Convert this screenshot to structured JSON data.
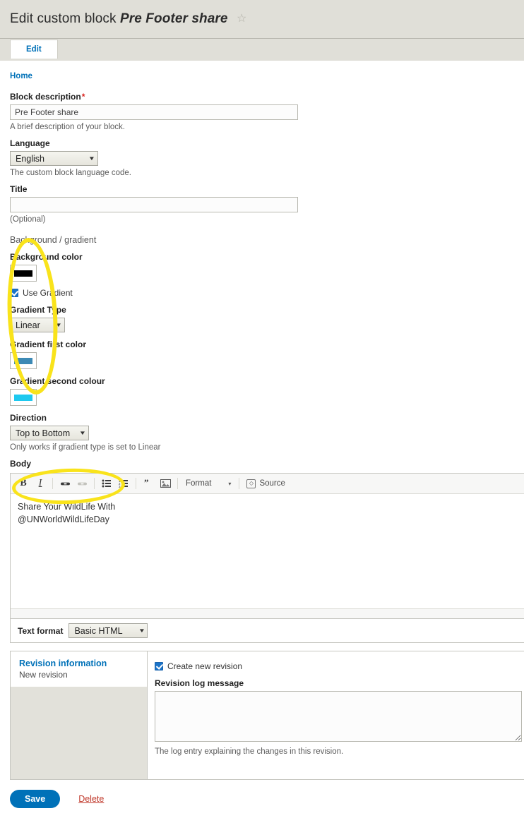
{
  "header": {
    "title_lead": "Edit custom block",
    "title_name": "Pre Footer share",
    "star_icon": "☆"
  },
  "tabs": [
    {
      "label": "Edit",
      "active": true
    }
  ],
  "breadcrumb": {
    "home_label": "Home"
  },
  "form": {
    "block_description": {
      "label": "Block description",
      "required_marker": "*",
      "value": "Pre Footer share",
      "help": "A brief description of your block."
    },
    "language": {
      "label": "Language",
      "selected": "English",
      "help": "The custom block language code."
    },
    "title": {
      "label": "Title",
      "value": "",
      "help": "(Optional)"
    },
    "background_section": {
      "legend": "Background / gradient",
      "background_color": {
        "label": "Background color",
        "value": "#000000"
      },
      "use_gradient": {
        "label": "Use Gradient",
        "checked": true
      },
      "gradient_type": {
        "label": "Gradient Type",
        "selected": "Linear"
      },
      "gradient_first_color": {
        "label": "Gradient first color",
        "value": "#3d8ab5"
      },
      "gradient_second_colour": {
        "label": "Gradient second colour",
        "value": "#1ec9ef"
      },
      "direction": {
        "label": "Direction",
        "selected": "Top to Bottom",
        "help": "Only works if gradient type is set to Linear"
      }
    },
    "body": {
      "label": "Body",
      "content_line1": "Share Your WildLife With",
      "content_line2": "@UNWorldWildLifeDay",
      "toolbar": [
        {
          "name": "bold-icon",
          "glyph": "B"
        },
        {
          "name": "italic-icon",
          "glyph": "I"
        },
        {
          "name": "link-icon",
          "glyph": "🔗"
        },
        {
          "name": "unlink-icon",
          "glyph": "🔗"
        },
        {
          "name": "bulleted-list-icon",
          "glyph": "☰"
        },
        {
          "name": "numbered-list-icon",
          "glyph": "☰"
        },
        {
          "name": "blockquote-icon",
          "glyph": "❞"
        },
        {
          "name": "image-icon",
          "glyph": "🖼"
        }
      ],
      "format_label": "Format",
      "source_label": "Source"
    },
    "text_format": {
      "label": "Text format",
      "selected": "Basic HTML"
    },
    "revision": {
      "side_title": "Revision information",
      "side_subtitle": "New revision",
      "create_new_revision_label": "Create new revision",
      "create_new_revision_checked": true,
      "log_label": "Revision log message",
      "log_value": "",
      "log_help": "The log entry explaining the changes in this revision."
    }
  },
  "actions": {
    "save_label": "Save",
    "delete_label": "Delete"
  },
  "colors": {
    "accent_blue": "#0071b8",
    "highlight_yellow": "#f9e31b",
    "danger_red": "#c0392b",
    "header_band": "#e0dfd8"
  }
}
